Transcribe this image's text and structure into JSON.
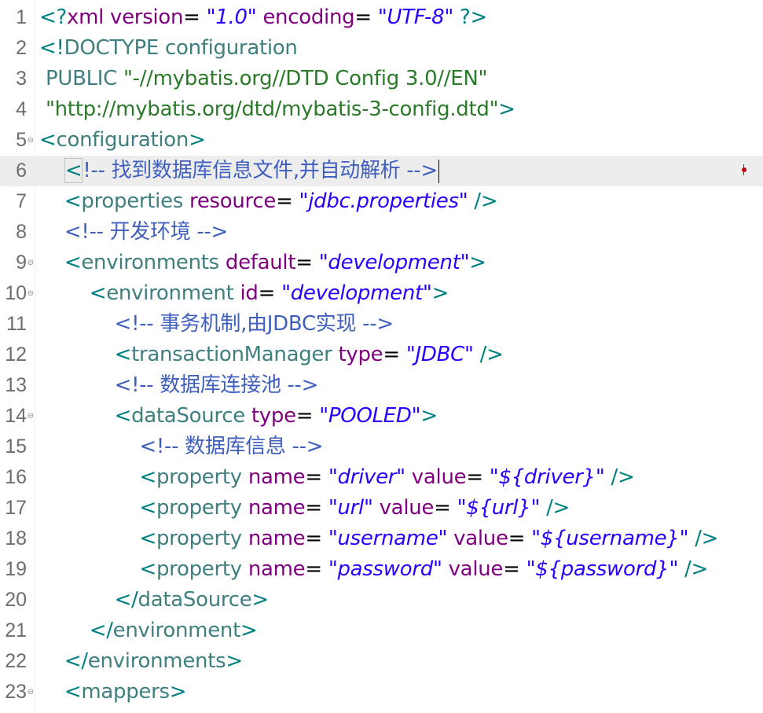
{
  "editor": {
    "lines": [
      {
        "number": "1",
        "fold": "",
        "current": false,
        "tokens": [
          {
            "c": "bracket",
            "t": "<?"
          },
          {
            "c": "pi",
            "t": "xml "
          },
          {
            "c": "attr",
            "t": "version"
          },
          {
            "c": "eq",
            "t": "= "
          },
          {
            "c": "val",
            "t": "\"1.0\""
          },
          {
            "c": "eq",
            "t": " "
          },
          {
            "c": "attr",
            "t": "encoding"
          },
          {
            "c": "eq",
            "t": "= "
          },
          {
            "c": "val",
            "t": "\"UTF-8\""
          },
          {
            "c": "eq",
            "t": " "
          },
          {
            "c": "bracket",
            "t": "?>"
          }
        ]
      },
      {
        "number": "2",
        "fold": "",
        "current": false,
        "tokens": [
          {
            "c": "bracket",
            "t": "<!"
          },
          {
            "c": "doctype",
            "t": "DOCTYPE configuration"
          }
        ]
      },
      {
        "number": "3",
        "fold": "",
        "current": false,
        "tokens": [
          {
            "c": "tag",
            "t": " PUBLIC "
          },
          {
            "c": "str",
            "t": "\"-//mybatis.org//DTD Config 3.0//EN\""
          }
        ]
      },
      {
        "number": "4",
        "fold": "",
        "current": false,
        "tokens": [
          {
            "c": "eq",
            "t": " "
          },
          {
            "c": "str",
            "t": "\"http://mybatis.org/dtd/mybatis-3-config.dtd\""
          },
          {
            "c": "bracket",
            "t": ">"
          }
        ]
      },
      {
        "number": "5",
        "fold": "⊖",
        "current": false,
        "tokens": [
          {
            "c": "bracket",
            "t": "<"
          },
          {
            "c": "tag",
            "t": "configuration"
          },
          {
            "c": "bracket",
            "t": ">"
          }
        ]
      },
      {
        "number": "6",
        "fold": "",
        "current": true,
        "tokens": [
          {
            "c": "eq",
            "t": "    "
          },
          {
            "c": "cursor",
            "t": "<"
          },
          {
            "c": "comment",
            "t": "!-- 找到数据库信息文件,并自动解析 -->"
          },
          {
            "c": "caret",
            "t": ""
          }
        ]
      },
      {
        "number": "7",
        "fold": "",
        "current": false,
        "tokens": [
          {
            "c": "eq",
            "t": "    "
          },
          {
            "c": "bracket",
            "t": "<"
          },
          {
            "c": "tag",
            "t": "properties "
          },
          {
            "c": "attr",
            "t": "resource"
          },
          {
            "c": "eq",
            "t": "= "
          },
          {
            "c": "val",
            "t": "\"jdbc.properties\""
          },
          {
            "c": "eq",
            "t": " "
          },
          {
            "c": "bracket",
            "t": "/>"
          }
        ]
      },
      {
        "number": "8",
        "fold": "",
        "current": false,
        "tokens": [
          {
            "c": "eq",
            "t": "    "
          },
          {
            "c": "comment",
            "t": "<!-- 开发环境 -->"
          }
        ]
      },
      {
        "number": "9",
        "fold": "⊖",
        "current": false,
        "tokens": [
          {
            "c": "eq",
            "t": "    "
          },
          {
            "c": "bracket",
            "t": "<"
          },
          {
            "c": "tag",
            "t": "environments "
          },
          {
            "c": "attr",
            "t": "default"
          },
          {
            "c": "eq",
            "t": "= "
          },
          {
            "c": "val",
            "t": "\"development\""
          },
          {
            "c": "bracket",
            "t": ">"
          }
        ]
      },
      {
        "number": "10",
        "fold": "⊖",
        "current": false,
        "tokens": [
          {
            "c": "eq",
            "t": "        "
          },
          {
            "c": "bracket",
            "t": "<"
          },
          {
            "c": "tag",
            "t": "environment "
          },
          {
            "c": "attr",
            "t": "id"
          },
          {
            "c": "eq",
            "t": "= "
          },
          {
            "c": "val",
            "t": "\"development\""
          },
          {
            "c": "bracket",
            "t": ">"
          }
        ]
      },
      {
        "number": "11",
        "fold": "",
        "current": false,
        "tokens": [
          {
            "c": "eq",
            "t": "            "
          },
          {
            "c": "comment",
            "t": "<!-- 事务机制,由JDBC实现 -->"
          }
        ]
      },
      {
        "number": "12",
        "fold": "",
        "current": false,
        "tokens": [
          {
            "c": "eq",
            "t": "            "
          },
          {
            "c": "bracket",
            "t": "<"
          },
          {
            "c": "tag",
            "t": "transactionManager "
          },
          {
            "c": "attr",
            "t": "type"
          },
          {
            "c": "eq",
            "t": "= "
          },
          {
            "c": "val",
            "t": "\"JDBC\""
          },
          {
            "c": "eq",
            "t": " "
          },
          {
            "c": "bracket",
            "t": "/>"
          }
        ]
      },
      {
        "number": "13",
        "fold": "",
        "current": false,
        "tokens": [
          {
            "c": "eq",
            "t": "            "
          },
          {
            "c": "comment",
            "t": "<!-- 数据库连接池 -->"
          }
        ]
      },
      {
        "number": "14",
        "fold": "⊖",
        "current": false,
        "tokens": [
          {
            "c": "eq",
            "t": "            "
          },
          {
            "c": "bracket",
            "t": "<"
          },
          {
            "c": "tag",
            "t": "dataSource "
          },
          {
            "c": "attr",
            "t": "type"
          },
          {
            "c": "eq",
            "t": "= "
          },
          {
            "c": "val",
            "t": "\"POOLED\""
          },
          {
            "c": "bracket",
            "t": ">"
          }
        ]
      },
      {
        "number": "15",
        "fold": "",
        "current": false,
        "tokens": [
          {
            "c": "eq",
            "t": "                "
          },
          {
            "c": "comment",
            "t": "<!-- 数据库信息 -->"
          }
        ]
      },
      {
        "number": "16",
        "fold": "",
        "current": false,
        "tokens": [
          {
            "c": "eq",
            "t": "                "
          },
          {
            "c": "bracket",
            "t": "<"
          },
          {
            "c": "tag",
            "t": "property "
          },
          {
            "c": "attr",
            "t": "name"
          },
          {
            "c": "eq",
            "t": "= "
          },
          {
            "c": "val",
            "t": "\"driver\""
          },
          {
            "c": "eq",
            "t": " "
          },
          {
            "c": "attr",
            "t": "value"
          },
          {
            "c": "eq",
            "t": "= "
          },
          {
            "c": "val",
            "t": "\"${driver}\""
          },
          {
            "c": "eq",
            "t": " "
          },
          {
            "c": "bracket",
            "t": "/>"
          }
        ]
      },
      {
        "number": "17",
        "fold": "",
        "current": false,
        "tokens": [
          {
            "c": "eq",
            "t": "                "
          },
          {
            "c": "bracket",
            "t": "<"
          },
          {
            "c": "tag",
            "t": "property "
          },
          {
            "c": "attr",
            "t": "name"
          },
          {
            "c": "eq",
            "t": "= "
          },
          {
            "c": "val",
            "t": "\"url\""
          },
          {
            "c": "eq",
            "t": " "
          },
          {
            "c": "attr",
            "t": "value"
          },
          {
            "c": "eq",
            "t": "= "
          },
          {
            "c": "val",
            "t": "\"${url}\""
          },
          {
            "c": "eq",
            "t": " "
          },
          {
            "c": "bracket",
            "t": "/>"
          }
        ]
      },
      {
        "number": "18",
        "fold": "",
        "current": false,
        "tokens": [
          {
            "c": "eq",
            "t": "                "
          },
          {
            "c": "bracket",
            "t": "<"
          },
          {
            "c": "tag",
            "t": "property "
          },
          {
            "c": "attr",
            "t": "name"
          },
          {
            "c": "eq",
            "t": "= "
          },
          {
            "c": "val",
            "t": "\"username\""
          },
          {
            "c": "eq",
            "t": " "
          },
          {
            "c": "attr",
            "t": "value"
          },
          {
            "c": "eq",
            "t": "= "
          },
          {
            "c": "val",
            "t": "\"${username}\""
          },
          {
            "c": "eq",
            "t": " "
          },
          {
            "c": "bracket",
            "t": "/>"
          }
        ]
      },
      {
        "number": "19",
        "fold": "",
        "current": false,
        "tokens": [
          {
            "c": "eq",
            "t": "                "
          },
          {
            "c": "bracket",
            "t": "<"
          },
          {
            "c": "tag",
            "t": "property "
          },
          {
            "c": "attr",
            "t": "name"
          },
          {
            "c": "eq",
            "t": "= "
          },
          {
            "c": "val",
            "t": "\"password\""
          },
          {
            "c": "eq",
            "t": " "
          },
          {
            "c": "attr",
            "t": "value"
          },
          {
            "c": "eq",
            "t": "= "
          },
          {
            "c": "val",
            "t": "\"${password}\""
          },
          {
            "c": "eq",
            "t": " "
          },
          {
            "c": "bracket",
            "t": "/>"
          }
        ]
      },
      {
        "number": "20",
        "fold": "",
        "current": false,
        "tokens": [
          {
            "c": "eq",
            "t": "            "
          },
          {
            "c": "bracket",
            "t": "</"
          },
          {
            "c": "tag",
            "t": "dataSource"
          },
          {
            "c": "bracket",
            "t": ">"
          }
        ]
      },
      {
        "number": "21",
        "fold": "",
        "current": false,
        "tokens": [
          {
            "c": "eq",
            "t": "        "
          },
          {
            "c": "bracket",
            "t": "</"
          },
          {
            "c": "tag",
            "t": "environment"
          },
          {
            "c": "bracket",
            "t": ">"
          }
        ]
      },
      {
        "number": "22",
        "fold": "",
        "current": false,
        "tokens": [
          {
            "c": "eq",
            "t": "    "
          },
          {
            "c": "bracket",
            "t": "</"
          },
          {
            "c": "tag",
            "t": "environments"
          },
          {
            "c": "bracket",
            "t": ">"
          }
        ]
      },
      {
        "number": "23",
        "fold": "⊖",
        "current": false,
        "tokens": [
          {
            "c": "eq",
            "t": "    "
          },
          {
            "c": "bracket",
            "t": "<"
          },
          {
            "c": "tag",
            "t": "mappers"
          },
          {
            "c": "bracket",
            "t": ">"
          }
        ]
      }
    ]
  },
  "colors": {
    "bracket": "#008080",
    "tag": "#3f7f7f",
    "attribute": "#7f007f",
    "value": "#2a00ff",
    "comment": "#3f5fbf",
    "doctype_string": "#2a7a2a",
    "current_line": "#ededed"
  }
}
